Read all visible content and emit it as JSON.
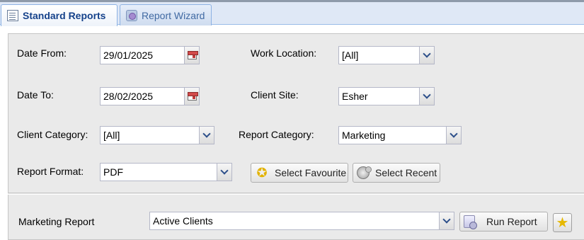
{
  "tabs": [
    {
      "label": "Standard Reports",
      "icon": "report-list-icon"
    },
    {
      "label": "Report Wizard",
      "icon": "wizard-icon"
    }
  ],
  "filters": {
    "date_from": {
      "label": "Date From:",
      "value": "29/01/2025"
    },
    "date_to": {
      "label": "Date To:",
      "value": "28/02/2025"
    },
    "client_category": {
      "label": "Client Category:",
      "value": "[All]"
    },
    "report_format": {
      "label": "Report Format:",
      "value": "PDF"
    },
    "work_location": {
      "label": "Work Location:",
      "value": "[All]"
    },
    "client_site": {
      "label": "Client Site:",
      "value": "Esher"
    },
    "report_category": {
      "label": "Report Category:",
      "value": "Marketing"
    }
  },
  "buttons": {
    "select_favourite": "Select Favourite",
    "select_recent": "Select Recent",
    "run_report": "Run Report"
  },
  "report": {
    "label": "Marketing Report",
    "value": "Active Clients"
  },
  "colors": {
    "accent": "#15428b",
    "tab_border": "#8db2e3",
    "panel_bg": "#eaeaea"
  }
}
